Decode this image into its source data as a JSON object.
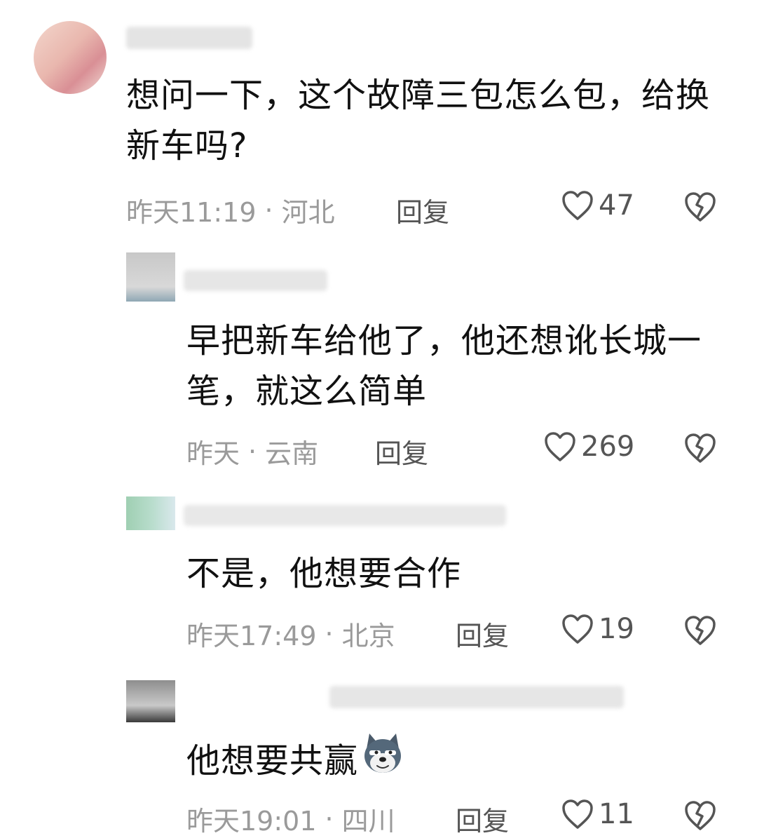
{
  "comments": [
    {
      "text": "想问一下，这个故障三包怎么包，给换新车吗?",
      "time": "昨天11:19",
      "dot": "·",
      "location": "河北",
      "reply_label": "回复",
      "likes": "47"
    },
    {
      "text": "早把新车给他了，他还想讹长城一笔，就这么简单",
      "time": "昨天",
      "dot": "·",
      "location": "云南",
      "reply_label": "回复",
      "likes": "269"
    },
    {
      "text": "不是，他想要合作",
      "time": "昨天17:49",
      "dot": "·",
      "location": "北京",
      "reply_label": "回复",
      "likes": "19"
    },
    {
      "text": "他想要共赢",
      "time": "昨天19:01",
      "dot": "·",
      "location": "四川",
      "reply_label": "回复",
      "likes": "11",
      "emoji": "dog-face-emoji"
    }
  ],
  "icons": {
    "like": "heart-outline-icon",
    "dislike": "broken-heart-icon"
  },
  "colors": {
    "text": "#111111",
    "meta": "#9a9a9a",
    "action": "#555555"
  }
}
